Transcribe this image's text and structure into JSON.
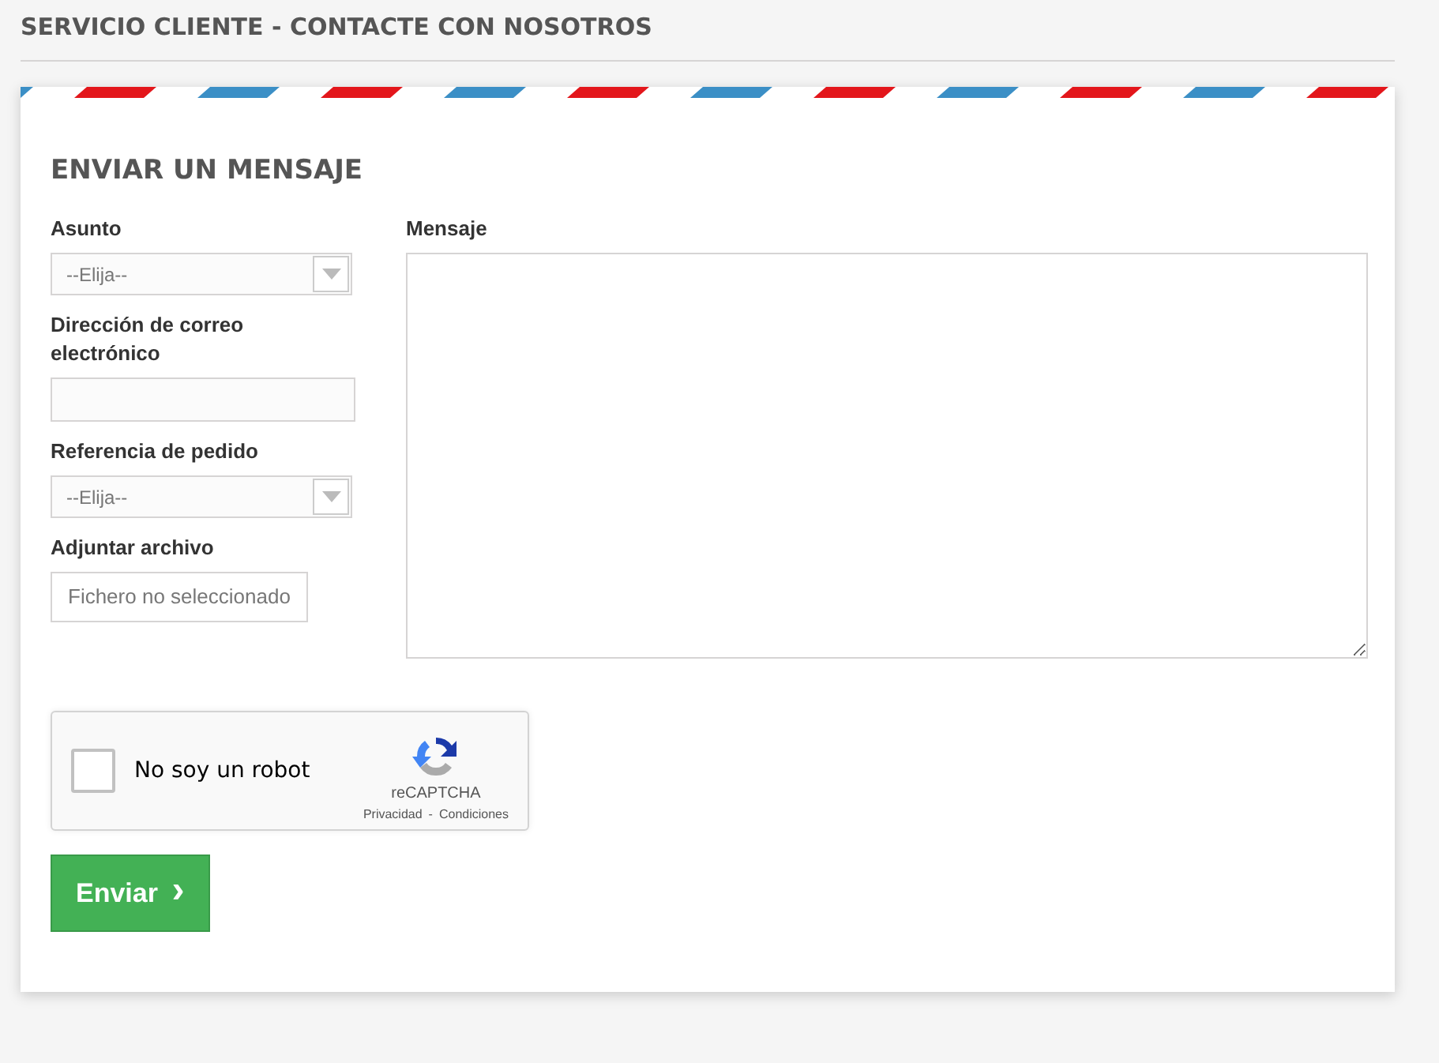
{
  "page_title": "SERVICIO CLIENTE - CONTACTE CON NOSOTROS",
  "form": {
    "heading": "ENVIAR UN MENSAJE",
    "fields": [
      {
        "kind": "select",
        "label": "Asunto",
        "value": "--Elija--"
      },
      {
        "kind": "text",
        "label": "Dirección de correo electrónico"
      },
      {
        "kind": "select",
        "label": "Referencia de pedido",
        "value": "--Elija--"
      },
      {
        "kind": "file",
        "label": "Adjuntar archivo",
        "value": "Fichero no seleccionado"
      }
    ],
    "message": {
      "label": "Mensaje"
    },
    "captcha": {
      "label": "No soy un robot",
      "checked": false,
      "brand": "reCAPTCHA",
      "links": [
        "Privacidad",
        "Condiciones"
      ],
      "separator": "-"
    },
    "submit": {
      "label": "Enviar",
      "icon": "›"
    }
  }
}
